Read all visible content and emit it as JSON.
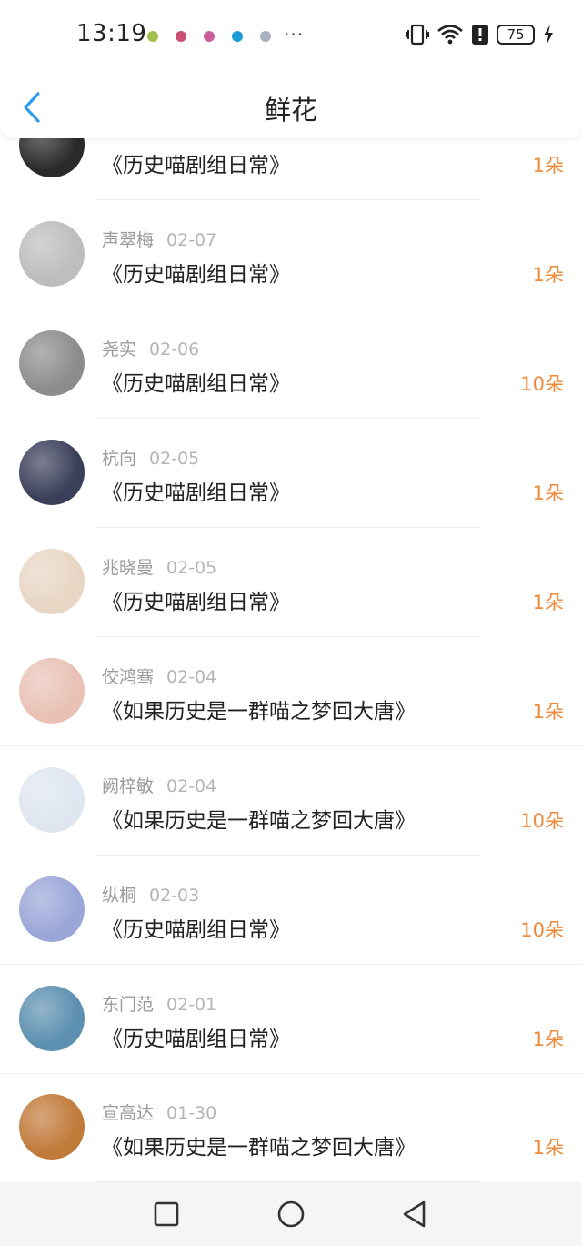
{
  "status_bar": {
    "time": "13:19",
    "more_icon": "...",
    "battery": "75",
    "notification_colors": [
      "#a5c04a",
      "#c94f76",
      "#c95f9a",
      "#1e9bd7",
      "#a9b0c0"
    ]
  },
  "header": {
    "title": "鲜花",
    "back_icon": "chevron-left-icon",
    "accent": "#2f9bf0"
  },
  "items": [
    {
      "name": "",
      "date": "",
      "book": "《历史喵剧组日常》",
      "count": "1朵",
      "avatar": "#2a2a2a"
    },
    {
      "name": "声翠梅",
      "date": "02-07",
      "book": "《历史喵剧组日常》",
      "count": "1朵",
      "avatar": "#bdbdbd"
    },
    {
      "name": "尧实",
      "date": "02-06",
      "book": "《历史喵剧组日常》",
      "count": "10朵",
      "avatar": "#8c8c8c"
    },
    {
      "name": "杭向",
      "date": "02-05",
      "book": "《历史喵剧组日常》",
      "count": "1朵",
      "avatar": "#3b3f5a"
    },
    {
      "name": "兆晓曼",
      "date": "02-05",
      "book": "《历史喵剧组日常》",
      "count": "1朵",
      "avatar": "#e8d6c4"
    },
    {
      "name": "佼鸿骞",
      "date": "02-04",
      "book": "《如果历史是一群喵之梦回大唐》",
      "count": "1朵",
      "avatar": "#e9c1b5"
    },
    {
      "name": "阙梓敏",
      "date": "02-04",
      "book": "《如果历史是一群喵之梦回大唐》",
      "count": "10朵",
      "avatar": "#dfe6ef"
    },
    {
      "name": "纵桐",
      "date": "02-03",
      "book": "《历史喵剧组日常》",
      "count": "10朵",
      "avatar": "#9aa6d8"
    },
    {
      "name": "东门范",
      "date": "02-01",
      "book": "《历史喵剧组日常》",
      "count": "1朵",
      "avatar": "#5c8fb0"
    },
    {
      "name": "宣高达",
      "date": "01-30",
      "book": "《如果历史是一群喵之梦回大唐》",
      "count": "1朵",
      "avatar": "#c07a3a"
    }
  ],
  "count_color": "#f08a3c",
  "nav_bar": {
    "recent_icon": "square-icon",
    "home_icon": "circle-icon",
    "back_icon": "triangle-back-icon"
  }
}
